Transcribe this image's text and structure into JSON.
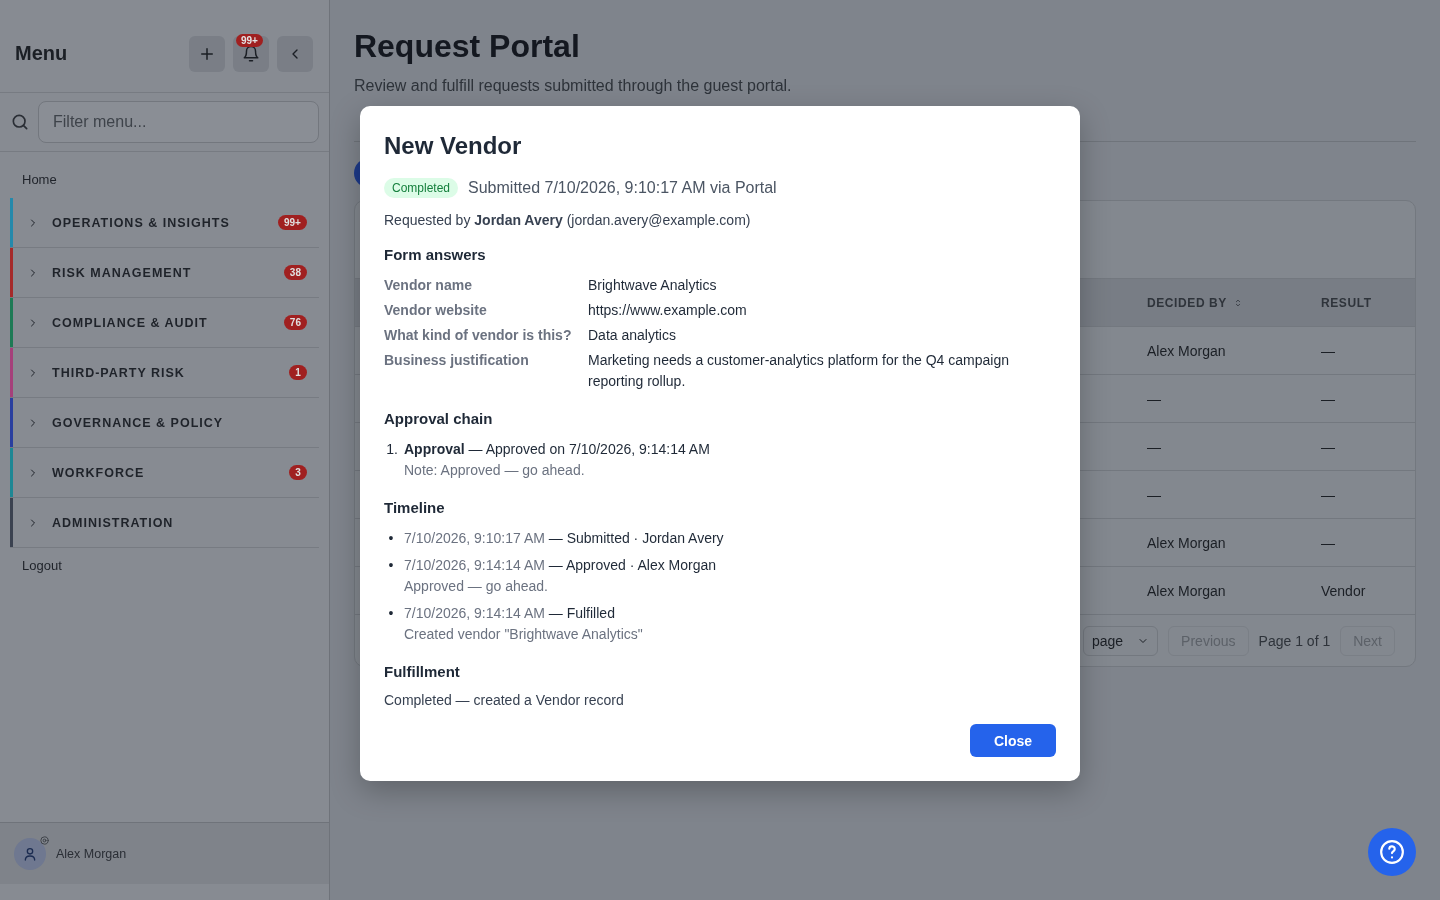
{
  "sidebar": {
    "title": "Menu",
    "notification_count": "99+",
    "filter": {
      "placeholder": "Filter menu..."
    },
    "home": "Home",
    "groups": [
      {
        "label": "OPERATIONS & INSIGHTS",
        "badge": "99+",
        "color": "#2589ab"
      },
      {
        "label": "RISK MANAGEMENT",
        "badge": "38",
        "color": "#a52a2a"
      },
      {
        "label": "COMPLIANCE & AUDIT",
        "badge": "76",
        "color": "#1e7a55"
      },
      {
        "label": "THIRD-PARTY RISK",
        "badge": "1",
        "color": "#a5407a"
      },
      {
        "label": "GOVERNANCE & POLICY",
        "color": "#2a3f9f"
      },
      {
        "label": "WORKFORCE",
        "badge": "3",
        "color": "#1e8794"
      },
      {
        "label": "ADMINISTRATION",
        "color": "#3b4250"
      }
    ],
    "logout": "Logout",
    "user": "Alex Morgan"
  },
  "page": {
    "title": "Request Portal",
    "subtitle": "Review and fulfill requests submitted through the guest portal.",
    "table": {
      "columns": [
        "DECIDED BY",
        "RESULT"
      ],
      "rows": [
        [
          "Alex Morgan",
          "—"
        ],
        [
          "—",
          "—"
        ],
        [
          "—",
          "—"
        ],
        [
          "—",
          "—"
        ],
        [
          "Alex Morgan",
          "—"
        ],
        [
          "Alex Morgan",
          "Vendor"
        ]
      ],
      "page_size": "page",
      "previous": "Previous",
      "page_info": "Page 1 of 1",
      "next": "Next"
    }
  },
  "modal": {
    "title": "New Vendor",
    "status": "Completed",
    "submitted": "Submitted 7/10/2026, 9:10:17 AM via Portal",
    "requested_by": "Requested by **Jordan Avery** (jordan.avery@example.com)",
    "form_heading": "Form answers",
    "answers": [
      {
        "label": "Vendor name",
        "value": "Brightwave Analytics"
      },
      {
        "label": "Vendor website",
        "value": "https://www.example.com"
      },
      {
        "label": "What kind of vendor is this?",
        "value": "Data analytics"
      },
      {
        "label": "Business justification",
        "value": "Marketing needs a customer-analytics platform for the Q4 campaign reporting rollup."
      }
    ],
    "approval_heading": "Approval chain",
    "approvals": [
      {
        "marker": "1.",
        "step": "Approval",
        "text": "— Approved on 7/10/2026, 9:14:14 AM",
        "note": "Note: Approved — go ahead."
      }
    ],
    "timeline_heading": "Timeline",
    "timeline": [
      {
        "marker": "•",
        "time": "7/10/2026, 9:10:17 AM",
        "event": "— Submitted · Jordan Avery"
      },
      {
        "marker": "•",
        "time": "7/10/2026, 9:14:14 AM",
        "event": "— Approved · Alex Morgan",
        "detail": "Approved — go ahead."
      },
      {
        "marker": "•",
        "time": "7/10/2026, 9:14:14 AM",
        "event": "— Fulfilled",
        "detail": "Created vendor \"Brightwave Analytics\""
      }
    ],
    "fulfillment_heading": "Fulfillment",
    "fulfillment": "Completed — created a Vendor record",
    "close": "Close"
  }
}
